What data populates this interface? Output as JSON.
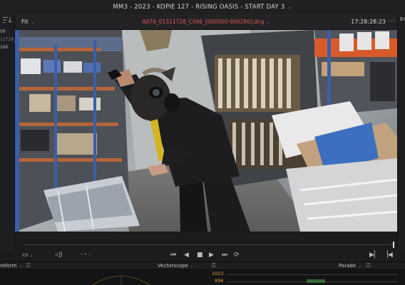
{
  "window": {
    "title": "MM3 - 2023 - KOPIE 127 - RISING OASIS - START DAY 3"
  },
  "left_panel": {
    "rows": [
      "09",
      "11728_",
      "160"
    ]
  },
  "viewer": {
    "zoom_label": "Fit",
    "clip_name": "A076_01311728_C096_[000000-000280].dng",
    "timecode": "17:28:28:23",
    "right_panel_label": "Er"
  },
  "scopes": {
    "left_label": "reform",
    "center_label": "Vectorscope",
    "right_label": "Parade",
    "scale_top": "1023",
    "scale_mid": "896"
  },
  "icons": [
    "sort-icon",
    "chevron-down-icon",
    "more-menu-icon",
    "viewer-mode-icon",
    "audio-icon",
    "jump-start-icon",
    "play-reverse-icon",
    "stop-icon",
    "play-icon",
    "jump-end-icon",
    "loop-icon",
    "next-clip-icon",
    "prev-clip-icon"
  ]
}
